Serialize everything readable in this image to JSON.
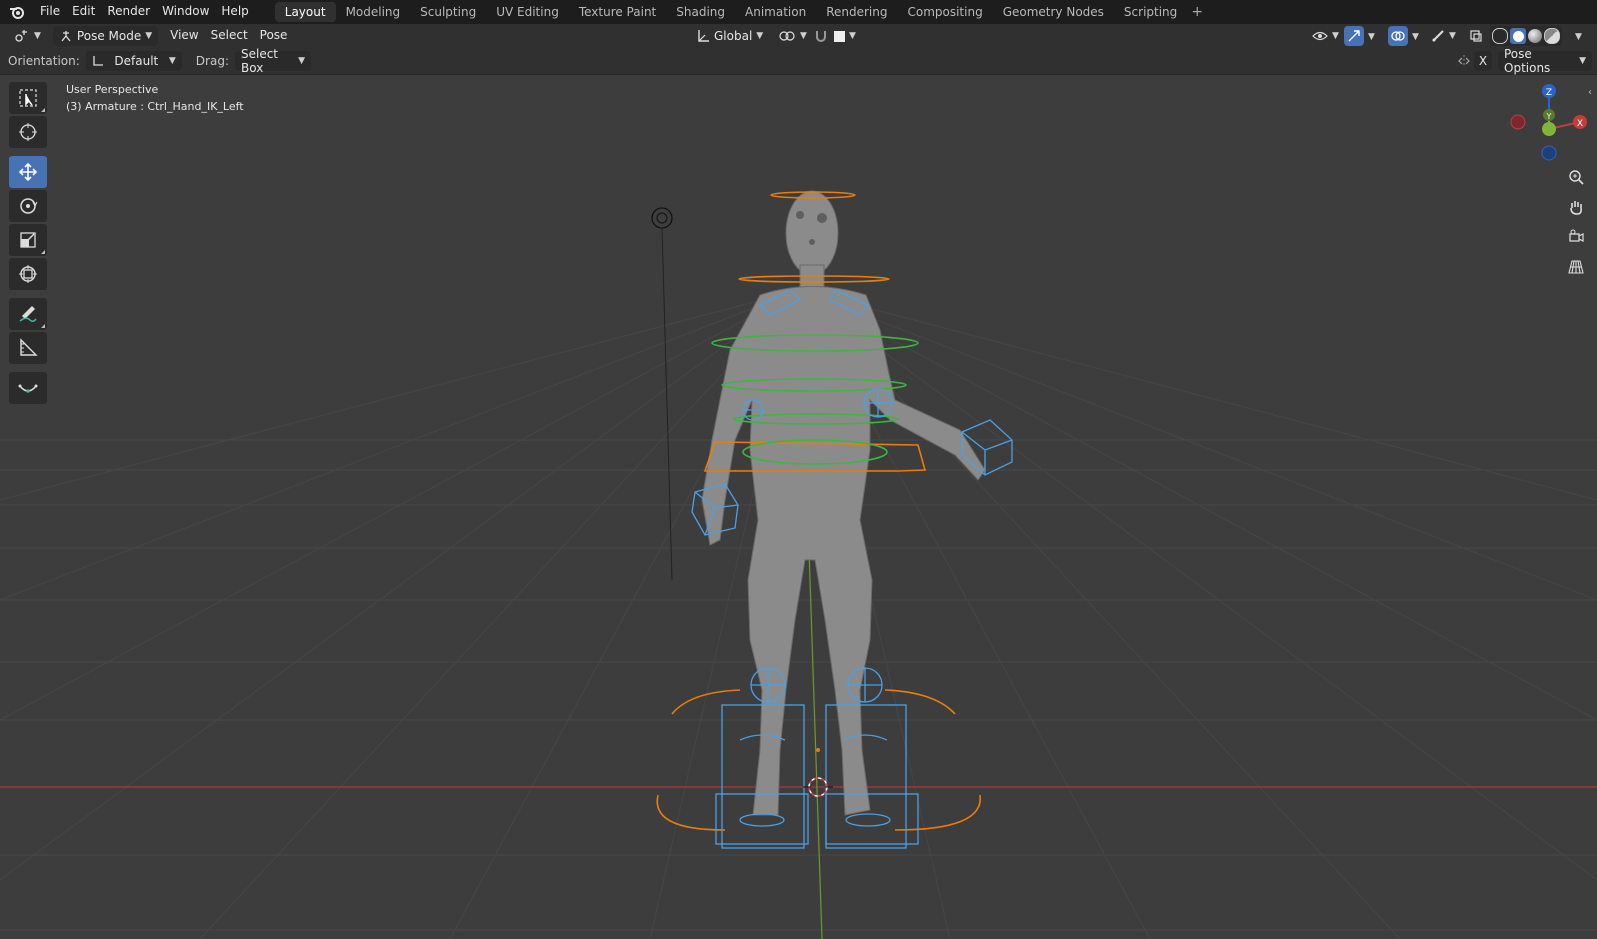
{
  "topbar": {
    "menu": [
      "File",
      "Edit",
      "Render",
      "Window",
      "Help"
    ],
    "workspace_tabs": [
      "Layout",
      "Modeling",
      "Sculpting",
      "UV Editing",
      "Texture Paint",
      "Shading",
      "Animation",
      "Rendering",
      "Compositing",
      "Geometry Nodes",
      "Scripting"
    ],
    "active_tab": "Layout",
    "add_tab": "+"
  },
  "header": {
    "mode": "Pose Mode",
    "menus": [
      "View",
      "Select",
      "Pose"
    ],
    "transform_orientation": "Global"
  },
  "tool_settings": {
    "orientation_label": "Orientation:",
    "orientation_value": "Default",
    "drag_label": "Drag:",
    "drag_value": "Select Box",
    "x_label": "X",
    "pose_options": "Pose Options"
  },
  "viewport": {
    "view_name": "User Perspective",
    "object_info": "(3) Armature : Ctrl_Hand_IK_Left",
    "gizmo": {
      "z": "Z",
      "y": "Y",
      "x": "X"
    }
  },
  "tools": [
    "select-box-icon",
    "cursor-icon",
    "move-icon",
    "rotate-icon",
    "scale-icon",
    "transform-icon",
    "annotate-icon",
    "measure-icon",
    "relax-icon"
  ],
  "colors": {
    "accent": "#4772b3",
    "orange": "#e87d0d",
    "bone_blue": "#4aa0e6",
    "bone_green": "#3fb53f",
    "axis_x": "#c8383a",
    "axis_y": "#7fb63a"
  }
}
